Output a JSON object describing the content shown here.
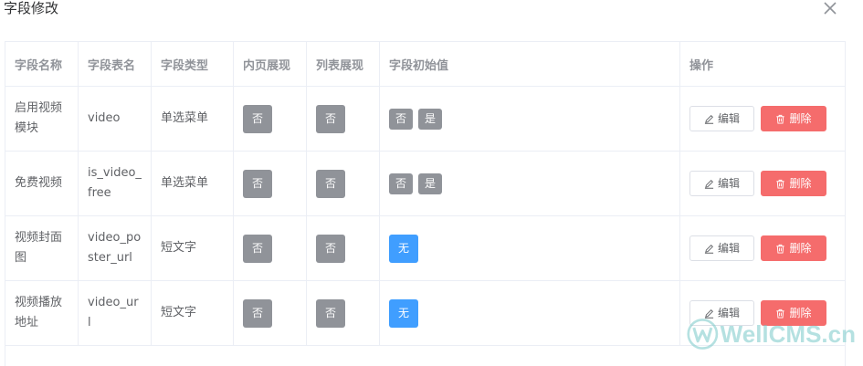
{
  "dialog": {
    "title": "字段修改",
    "close_icon": "close-icon"
  },
  "table": {
    "headers": [
      "字段名称",
      "字段表名",
      "字段类型",
      "内页展现",
      "列表展现",
      "字段初始值",
      "操作"
    ],
    "rows": [
      {
        "name": "启用视频模块",
        "table_name": "video",
        "type": "单选菜单",
        "page_show": "否",
        "list_show": "否",
        "initial": [
          "否",
          "是"
        ],
        "initial_style": "default",
        "edit": "编辑",
        "delete": "删除"
      },
      {
        "name": "免费视频",
        "table_name": "is_video_free",
        "type": "单选菜单",
        "page_show": "否",
        "list_show": "否",
        "initial": [
          "否",
          "是"
        ],
        "initial_style": "default",
        "edit": "编辑",
        "delete": "删除"
      },
      {
        "name": "视频封面图",
        "table_name": "video_poster_url",
        "type": "短文字",
        "page_show": "否",
        "list_show": "否",
        "initial": [
          "无"
        ],
        "initial_style": "primary",
        "edit": "编辑",
        "delete": "删除"
      },
      {
        "name": "视频播放地址",
        "table_name": "video_url",
        "type": "短文字",
        "page_show": "否",
        "list_show": "否",
        "initial": [
          "无"
        ],
        "initial_style": "primary",
        "edit": "编辑",
        "delete": "删除"
      }
    ]
  },
  "watermark": {
    "text": "WellCMS.cn"
  },
  "colors": {
    "tag_gray": "#909399",
    "tag_primary": "#409eff",
    "danger": "#f56c6c",
    "border": "#ebeef5"
  }
}
